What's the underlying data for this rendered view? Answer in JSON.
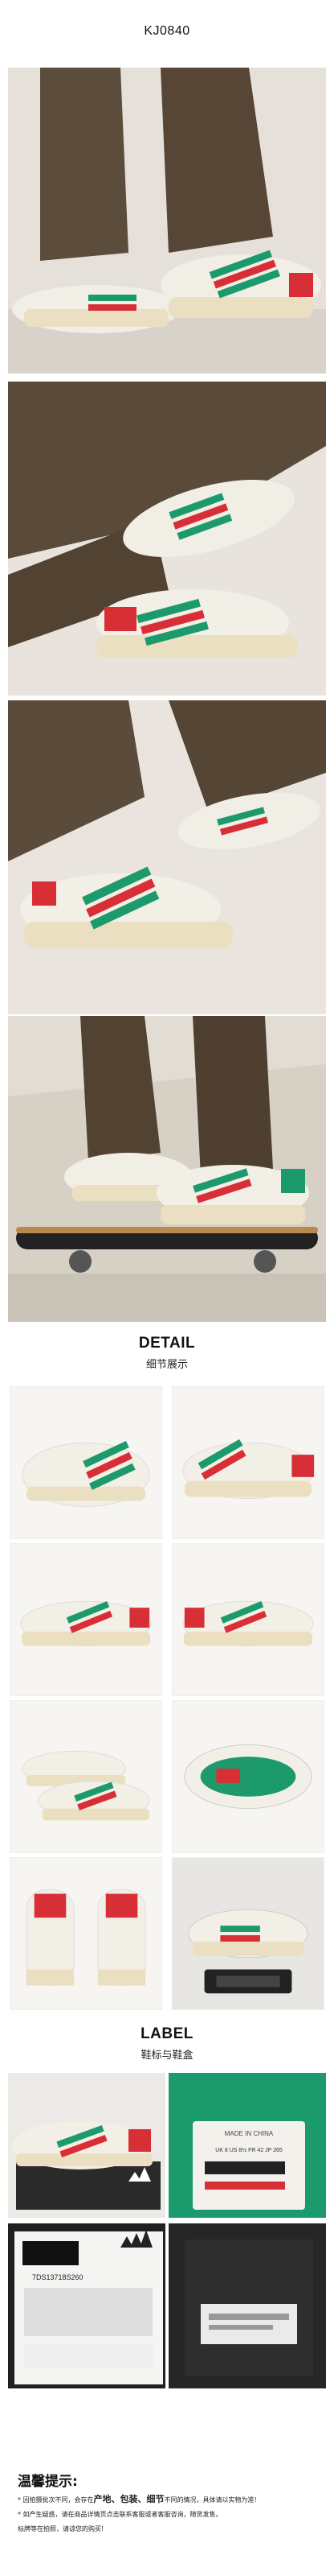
{
  "product": {
    "code": "KJ0840"
  },
  "detail_section": {
    "title_en": "DETAIL",
    "title_cn": "细节展示"
  },
  "label_section": {
    "title_en": "LABEL",
    "title_cn": "鞋标与鞋盒"
  },
  "tag_texts": {
    "made_in": "MADE IN CHINA",
    "sizes": "UK 8  US 8½  FR 42  JP 265",
    "box_code": "7DS13718S260"
  },
  "tips": {
    "title": "温馨提示:",
    "line1": "* 因拍摄批次不同，会存在产地、包装、细节不同的情况，具体请以实物为准!",
    "line1_pre": "* 因拍摄批次不同，会存在",
    "line1_bold1": "产地、",
    "line1_bold2": "包装、",
    "line1_bold3": "细节",
    "line1_post": "不同的情况，具体请以实物为准!",
    "line2": "* 如产生疑惑，请在商品详情页点击联系客服或者客服咨询，随货发售。",
    "line3": "  标牌等在拍照，请谅您的购买!"
  },
  "colors": {
    "shoe_white": "#f2efe6",
    "sole_cream": "#ece0c2",
    "stripe_green": "#1d9a6c",
    "stripe_red": "#d82f37",
    "pants_brown": "#5a4a3a"
  }
}
